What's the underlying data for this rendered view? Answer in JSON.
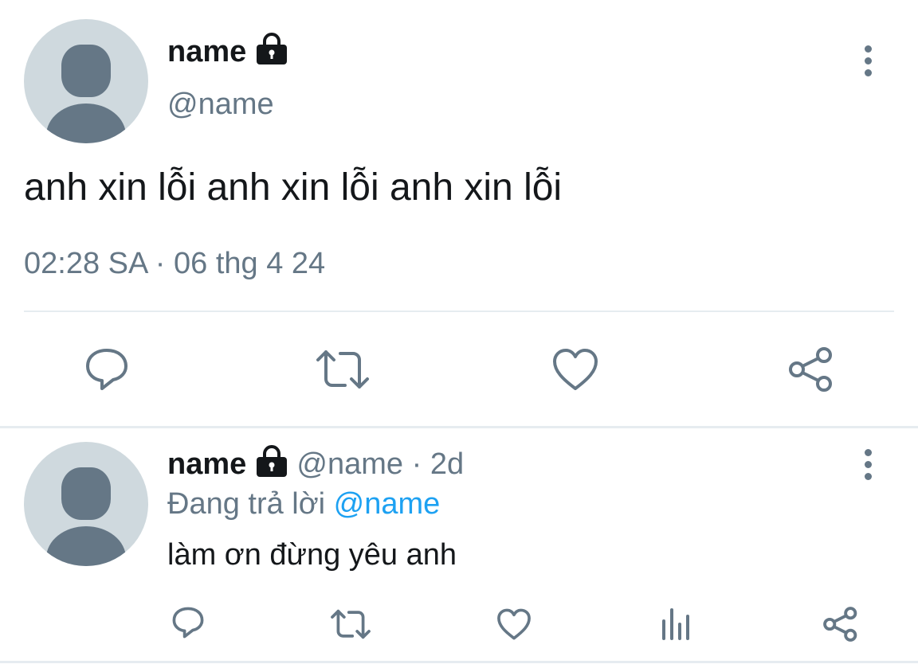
{
  "main_tweet": {
    "display_name": "name",
    "handle": "@name",
    "text": "anh xin lỗi anh xin lỗi anh xin lỗi",
    "timestamp": "02:28 SA · 06 thg 4 24",
    "actions": [
      "reply-icon",
      "retweet-icon",
      "like-icon",
      "share-icon"
    ]
  },
  "reply_tweet": {
    "display_name": "name",
    "handle": "@name",
    "separator": " · ",
    "time_ago": "2d",
    "replying_to_label": "Đang trả lời ",
    "replying_to_handle": "@name",
    "text": "làm ơn đừng yêu anh",
    "actions": [
      "reply-icon",
      "retweet-icon",
      "like-icon",
      "analytics-icon",
      "share-icon"
    ]
  },
  "colors": {
    "text_primary": "#14171a",
    "text_secondary": "#657786",
    "link": "#1da1f2",
    "avatar_bg": "#cfd9de",
    "divider": "#e6ecf0"
  }
}
